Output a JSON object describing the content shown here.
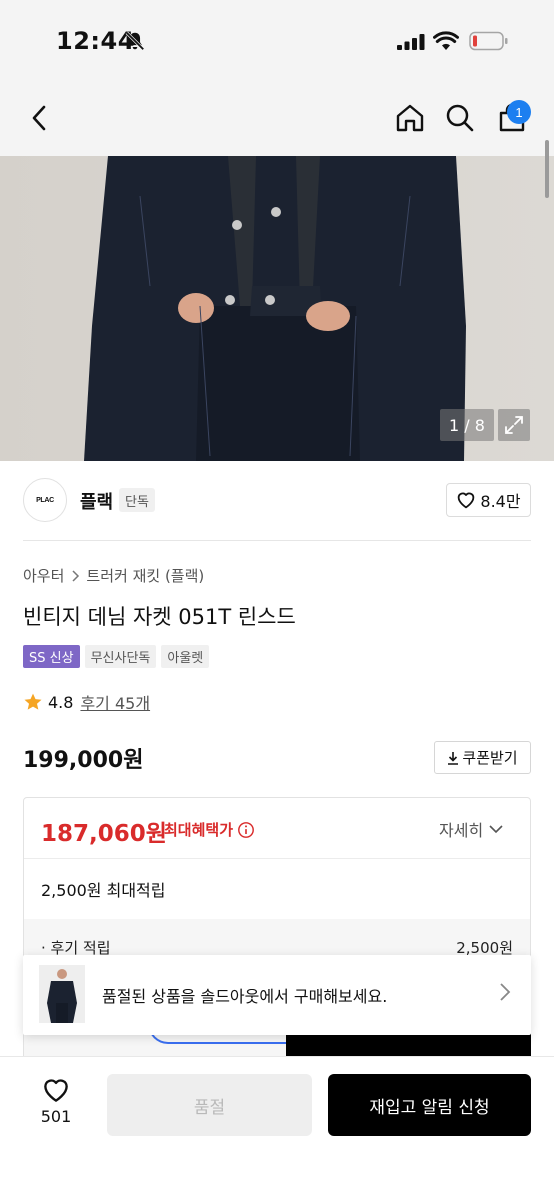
{
  "status_bar": {
    "time": "12:44"
  },
  "nav": {
    "cart_count": "1"
  },
  "gallery": {
    "counter": "1 / 8"
  },
  "brand": {
    "logo_text": "PLAC",
    "name": "플랙",
    "tag": "단독",
    "likes": "8.4만"
  },
  "product": {
    "breadcrumb": [
      "아우터",
      "트러커 재킷 (플랙)"
    ],
    "title": "빈티지 데님 자켓 051T 린스드",
    "badges": [
      "SS 신상",
      "무신사단독",
      "아울렛"
    ],
    "rating": "4.8",
    "review": "후기 45개",
    "price": "199,000원",
    "coupon_label": "쿠폰받기"
  },
  "benefit": {
    "max_price": "187,060원",
    "max_label": "최대혜택가",
    "detail_label": "자세히",
    "points": "2,500원 최대적립",
    "review_points_label": "· 후기 적립",
    "review_points_amount": "2,500원"
  },
  "soldout_banner": {
    "text": "품절된 상품을 솔드아웃에서 구매해보세요."
  },
  "bottom": {
    "wish_count": "501",
    "soldout_label": "품절",
    "restock_label": "재입고 알림 신청"
  },
  "colors": {
    "accent_red": "#d92b2b",
    "badge_purple": "#7e67c6",
    "cart_badge": "#1d7ff0",
    "denim": "#1b2230"
  }
}
